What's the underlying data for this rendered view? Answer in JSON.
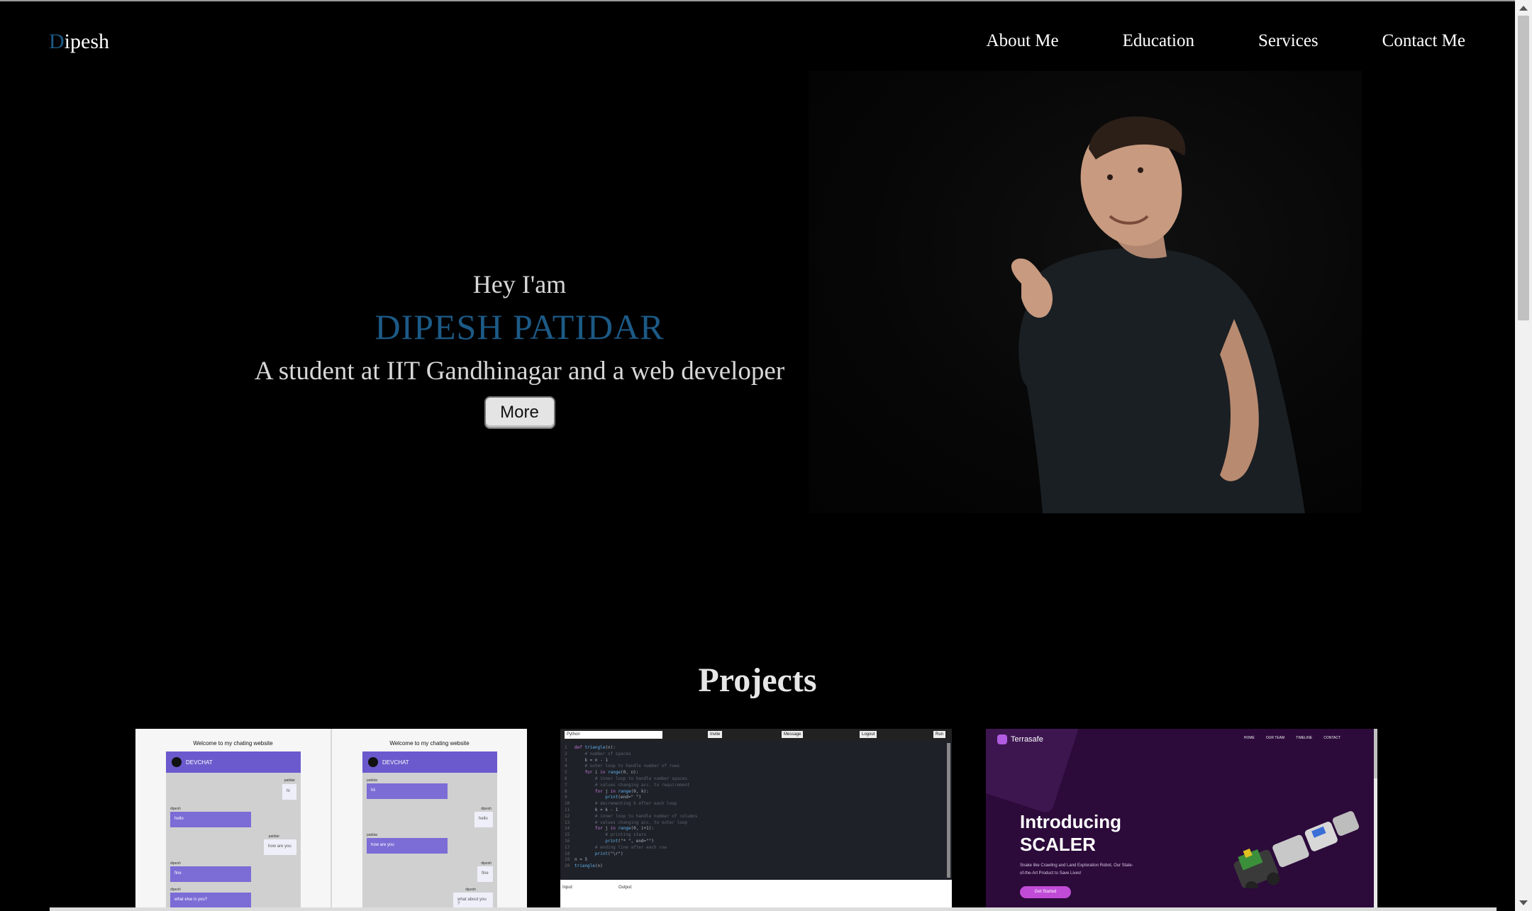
{
  "nav": {
    "logo_first": "D",
    "logo_rest": "ipesh",
    "links": [
      "About Me",
      "Education",
      "Services",
      "Contact Me"
    ]
  },
  "hero": {
    "greeting": "Hey I'am",
    "name": "DIPESH PATIDAR",
    "tagline": "A student at IIT Gandhinagar and a web developer",
    "button": "More"
  },
  "projects": {
    "title": "Projects",
    "chat_card": {
      "heading": "Welcome to my chating website",
      "app_name": "DEVCHAT",
      "left_users": [
        "patidar",
        "dipesh",
        "patidar",
        "dipesh",
        "dipesh"
      ],
      "left_msgs": [
        "hi",
        "hello",
        "how are you",
        "fine",
        "what else is you?"
      ],
      "right_users": [
        "patidar",
        "dipesh",
        "patidar",
        "dipesh",
        "dipesh"
      ],
      "right_msgs": [
        "hii",
        "hello",
        "how are you",
        "fine",
        "what about you ?"
      ]
    },
    "code_card": {
      "language": "Python",
      "buttons": [
        "Invite",
        "Message",
        "Logout",
        "Run"
      ],
      "input_label": "Input:",
      "output_label": "Output:"
    },
    "terra_card": {
      "brand": "Terrasafe",
      "nav": [
        "HOME",
        "OUR TEAM",
        "TIMELINE",
        "CONTACT"
      ],
      "headline_1": "Introducing",
      "headline_2": "SCALER",
      "subtext": "Snake like Crawling and Land Exploration Robot, Our State-of-the-Art Product to Save Lives!",
      "button": "Get Started"
    }
  },
  "colors": {
    "accent": "#1c5a86",
    "background": "#000000"
  }
}
